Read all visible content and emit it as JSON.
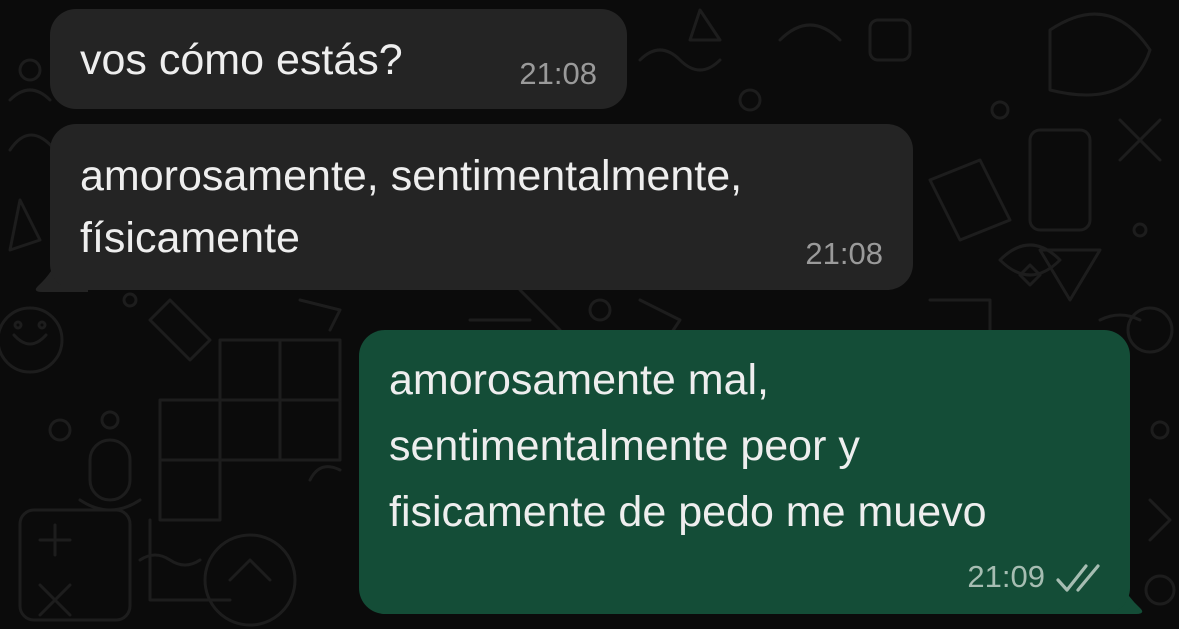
{
  "colors": {
    "background": "#0b0b0b",
    "incoming_bubble": "#242424",
    "outgoing_bubble": "#144d37",
    "text": "#eeeeee",
    "timestamp_incoming": "#9a9a9a",
    "timestamp_outgoing": "#a6bdb2",
    "read_ticks": "#a6bdb2",
    "wallpaper_doodles": "#1c1c1c"
  },
  "messages": [
    {
      "direction": "incoming",
      "lines": [
        "vos cómo estás?"
      ],
      "time": "21:08"
    },
    {
      "direction": "incoming",
      "lines": [
        "amorosamente, sentimentalmente,",
        "físicamente"
      ],
      "time": "21:08"
    },
    {
      "direction": "outgoing",
      "lines": [
        "amorosamente mal,",
        "sentimentalmente peor y",
        "fisicamente de pedo me muevo"
      ],
      "time": "21:09",
      "status_icon": "double-check-icon"
    }
  ]
}
